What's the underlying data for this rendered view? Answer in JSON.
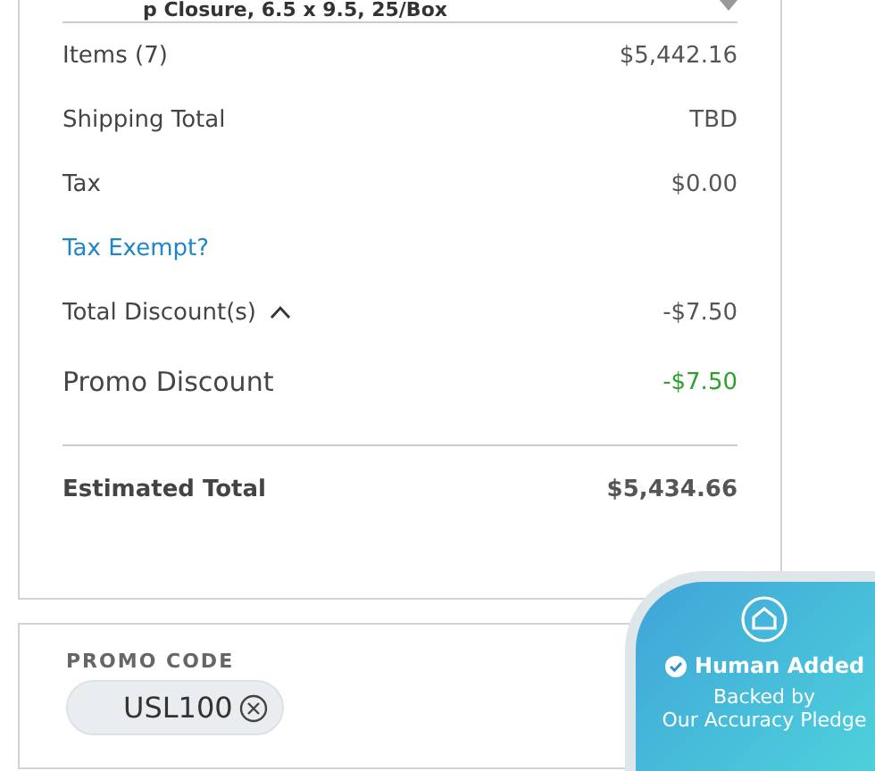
{
  "item_title": "p Closure, 6.5 x 9.5, 25/Box",
  "summary": [
    {
      "kind": "line",
      "label": "Items (7)",
      "value": "$5,442.16"
    },
    {
      "kind": "line",
      "label": "Shipping Total",
      "value": "TBD"
    },
    {
      "kind": "line",
      "label": "Tax",
      "value": "$0.00"
    },
    {
      "kind": "link",
      "label": "Tax Exempt?"
    },
    {
      "kind": "toggle",
      "label": "Total Discount(s)",
      "value": "-$7.50",
      "expanded": true
    },
    {
      "kind": "promo",
      "label": "Promo Discount",
      "value": "-$7.50"
    },
    {
      "kind": "total",
      "label": "Estimated Total",
      "value": "$5,434.66"
    }
  ],
  "promo": {
    "heading": "PROMO CODE",
    "code": "USL100"
  },
  "pledge": {
    "title": "Human Added",
    "line_1": "Backed by",
    "line_2": "Our Accuracy Pledge"
  }
}
